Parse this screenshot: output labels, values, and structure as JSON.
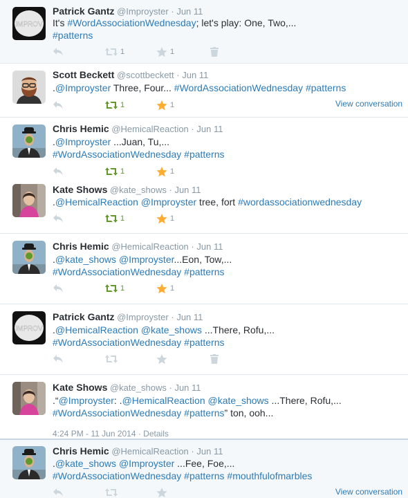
{
  "tweets": [
    {
      "name": "Patrick Gantz",
      "handle": "@Improyster",
      "time": "Jun 11",
      "text_parts": [
        "It's ",
        "#WordAssociationWednesday",
        "; let's play: One, Two,..."
      ],
      "text_line2": [
        "#patterns"
      ],
      "retweets": "1",
      "favorites": "1",
      "avatar": "improv-pill"
    },
    {
      "name": "Scott Beckett",
      "handle": "@scottbeckett",
      "time": "Jun 11",
      "text_parts": [
        ".",
        "@Improyster",
        " Three, Four... ",
        "#WordAssociationWednesday",
        " ",
        "#patterns"
      ],
      "retweets": "1",
      "favorites": "1",
      "view": "View conversation",
      "avatar": "bearded-man"
    },
    {
      "name": "Chris Hemic",
      "handle": "@HemicalReaction",
      "time": "Jun 11",
      "text_parts": [
        ".",
        "@Improyster",
        " ...Juan, Tu,..."
      ],
      "text_line2": [
        "#WordAssociationWednesday",
        " ",
        "#patterns"
      ],
      "retweets": "1",
      "favorites": "1",
      "avatar": "bowler-hat-man"
    },
    {
      "name": "Kate Shows",
      "handle": "@kate_shows",
      "time": "Jun 11",
      "text_parts": [
        ".",
        "@HemicalReaction",
        " ",
        "@Improyster",
        " tree, fort ",
        "#wordassociationwednesday"
      ],
      "retweets": "1",
      "favorites": "1",
      "avatar": "woman-pink-jacket"
    },
    {
      "name": "Chris Hemic",
      "handle": "@HemicalReaction",
      "time": "Jun 11",
      "text_parts": [
        ".",
        "@kate_shows",
        " ",
        "@Improyster",
        "...Eon, Tow,..."
      ],
      "text_line2": [
        "#WordAssociationWednesday",
        " ",
        "#patterns"
      ],
      "retweets": "1",
      "favorites": "1",
      "avatar": "bowler-hat-man"
    },
    {
      "name": "Patrick Gantz",
      "handle": "@Improyster",
      "time": "Jun 11",
      "text_parts": [
        ".",
        "@HemicalReaction",
        " ",
        "@kate_shows",
        " ...There, Rofu,..."
      ],
      "text_line2": [
        "#WordAssociationWednesday",
        " ",
        "#patterns"
      ],
      "avatar": "improv-pill"
    },
    {
      "name": "Kate Shows",
      "handle": "@kate_shows",
      "time": "Jun 11",
      "text_parts": [
        ".“",
        "@Improyster",
        ": .",
        "@HemicalReaction",
        " ",
        "@kate_shows",
        " ...There, Rofu,..."
      ],
      "text_line2": [
        "#WordAssociationWednesday",
        " ",
        "#patterns",
        "” ton, ooh..."
      ],
      "detail": "4:24 PM - 11 Jun 2014 · Details",
      "avatar": "woman-pink-jacket"
    },
    {
      "name": "Chris Hemic",
      "handle": "@HemicalReaction",
      "time": "Jun 11",
      "text_parts": [
        ".",
        "@kate_shows",
        " ",
        "@Improyster",
        " ...Fee, Foe,..."
      ],
      "text_line2": [
        "#WordAssociationWednesday",
        " ",
        "#patterns",
        " ",
        "#mouthfulofmarbles"
      ],
      "view": "View conversation",
      "avatar": "bowler-hat-man"
    }
  ],
  "avatar_texts": {
    "improv": "IMPROV"
  },
  "colors": {
    "link": "#2b7bb9",
    "retweet_active": "#609928",
    "favorite_active": "#ffac33",
    "icon_inactive": "#ccd6dd",
    "meta": "#8899a6"
  },
  "separator": "·"
}
